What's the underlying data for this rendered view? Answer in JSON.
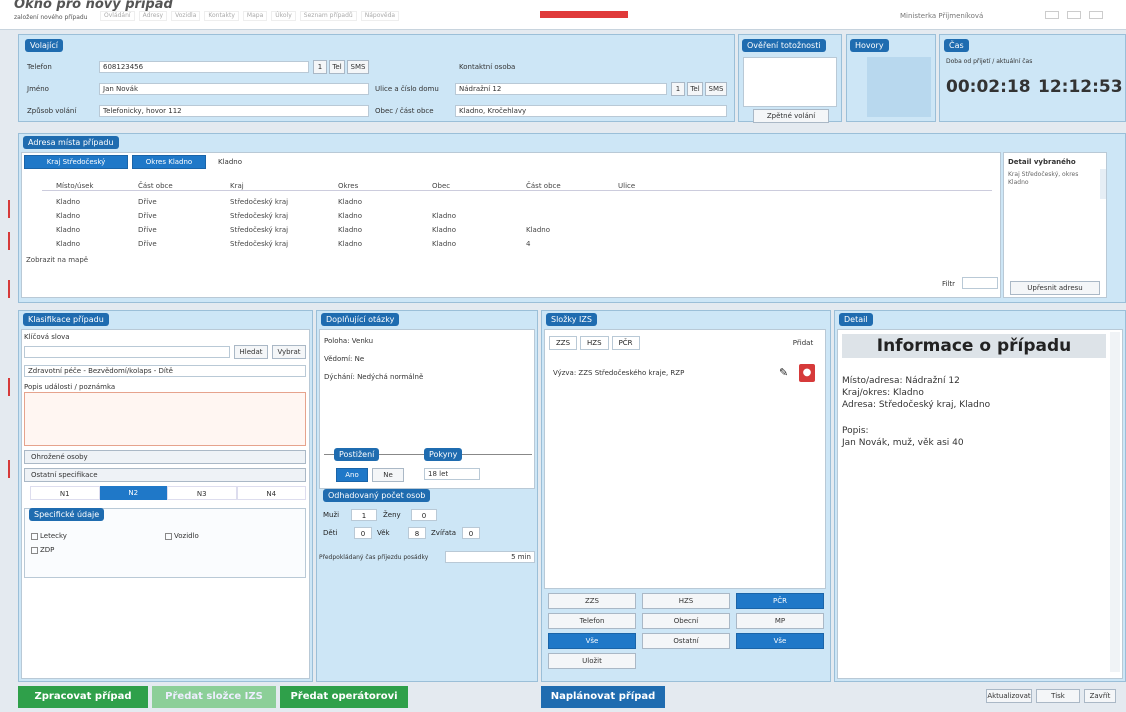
{
  "window": {
    "title": "Okno pro nový případ",
    "sub": "založení nového případu",
    "nav_items": [
      "Ovládání",
      "Adresy",
      "Vozidla",
      "Kontakty",
      "Mapa",
      "Úkoly",
      "Seznam případů",
      "Nápověda"
    ],
    "user": "Ministerka Příjmeníková"
  },
  "volajici": {
    "header": "Volající",
    "telefon_label": "Telefon",
    "telefon_value": "608123456",
    "small_btns": [
      "1",
      "Tel",
      "SMS"
    ],
    "kontakt_label": "Kontaktní osoba",
    "jmeno_label": "Jméno",
    "jmeno_value": "Jan Novák",
    "stat_label": "Ulice a číslo domu",
    "stat_value": "Nádražní 12",
    "small_btns2": [
      "1",
      "Tel",
      "SMS"
    ],
    "typ_label": "Způsob volání",
    "typ_value": "Telefonicky, hovor 112",
    "obec_label": "Obec / část obce",
    "obec_value": "Kladno, Kročehlavy"
  },
  "overeni": {
    "header": "Ověření totožnosti",
    "button": "Zpětné volání"
  },
  "hovor": {
    "header": "Hovory"
  },
  "cas": {
    "header": "Čas",
    "label": "Doba od přijetí / aktuální čas",
    "elapsed": "00:02:18",
    "clock": "12:12:53"
  },
  "adresa": {
    "header": "Adresa místa případu",
    "tabs": [
      "Kraj Středočeský",
      "Okres Kladno",
      "Kladno"
    ],
    "columns": [
      "Místo/úsek",
      "Část obce",
      "Kraj",
      "Okres",
      "Obec",
      "Část obce",
      "Ulice"
    ],
    "rows": [
      [
        "Kladno",
        "Dříve",
        "Středočeský kraj",
        "Kladno",
        "",
        "",
        ""
      ],
      [
        "Kladno",
        "Dříve",
        "Středočeský kraj",
        "Kladno",
        "Kladno",
        "",
        ""
      ],
      [
        "Kladno",
        "Dříve",
        "Středočeský kraj",
        "Kladno",
        "Kladno",
        "Kladno",
        ""
      ],
      [
        "Kladno",
        "Dříve",
        "Středočeský kraj",
        "Kladno",
        "Kladno",
        "4",
        ""
      ]
    ],
    "footer": "Zobrazit na mapě",
    "filter_label": "Filtr",
    "side_title": "Detail vybraného",
    "side_text": "Kraj Středočeský, okres Kladno",
    "side_btn": "Upřesnit adresu"
  },
  "klasifikace": {
    "header": "Klasifikace případu",
    "hint_label": "Klíčová slova",
    "search_btns": [
      "Hledat",
      "Vybrat"
    ],
    "select_value": "Zdravotní péče - Bezvědomí/kolaps - Dítě",
    "text_label": "Popis události / poznámka",
    "sections": [
      "Ohrožené osoby",
      "Ostatní specifikace"
    ],
    "segments": [
      "N1",
      "N2",
      "N3",
      "N4"
    ],
    "seg_active": 1,
    "subheader": "Specifické údaje",
    "checks": [
      "Letecky",
      "ZDP"
    ],
    "check2": "Vozidlo"
  },
  "dotaznik": {
    "header": "Doplňující otázky",
    "rows": [
      "Poloha: Venku",
      "Vědomí: Ne",
      "Dýchání: Nedýchá normálně"
    ],
    "badges": [
      "Postižení",
      "Pokyny"
    ],
    "btns": [
      "Ano",
      "Ne"
    ],
    "val": "18 let",
    "subheader": "Odhadovaný počet osob",
    "grid1": [
      "Muži",
      "1",
      "Ženy",
      "0"
    ],
    "grid2": [
      "Děti",
      "0",
      "Věk",
      "8",
      "Zvířata",
      "0"
    ],
    "bottom_label": "Předpokládaný čas příjezdu posádky",
    "bottom_value": "5 min"
  },
  "slozky": {
    "header": "Složky IZS",
    "tabs": [
      "ZZS",
      "HZS",
      "PČR"
    ],
    "right_btn": "Přidat",
    "item": "Výzva: ZZS Středočeského kraje, RZP",
    "grid": [
      {
        "t": "ZZS",
        "b": false
      },
      {
        "t": "HZS",
        "b": false
      },
      {
        "t": "PČR",
        "b": true
      },
      {
        "t": "Telefon",
        "b": false
      },
      {
        "t": "Obecní",
        "b": false
      },
      {
        "t": "MP",
        "b": false
      },
      {
        "t": "Vše",
        "b": true
      },
      {
        "t": "Ostatní",
        "b": false
      },
      {
        "t": "Vše",
        "b": true
      },
      {
        "t": "Uložit",
        "b": false
      }
    ]
  },
  "detail": {
    "header": "Detail",
    "title": "Informace o případu",
    "lines": [
      "Místo/adresa: Nádražní 12",
      "Kraj/okres: Kladno",
      "Adresa: Středočeský kraj, Kladno"
    ],
    "lines2": [
      "Popis:",
      "Jan Novák, muž, věk asi 40"
    ]
  },
  "footer": {
    "btn1": "Zpracovat případ",
    "btn2": "Předat složce IZS",
    "btn3": "Předat operátorovi",
    "btn4": "Naplánovat případ",
    "right": [
      "Aktualizovat",
      "Tisk",
      "Zavřít"
    ]
  },
  "colors": {
    "accent": "#1f6cb0",
    "panel": "#cde6f6",
    "green": "#2fa04a",
    "red": "#d63a3a"
  }
}
